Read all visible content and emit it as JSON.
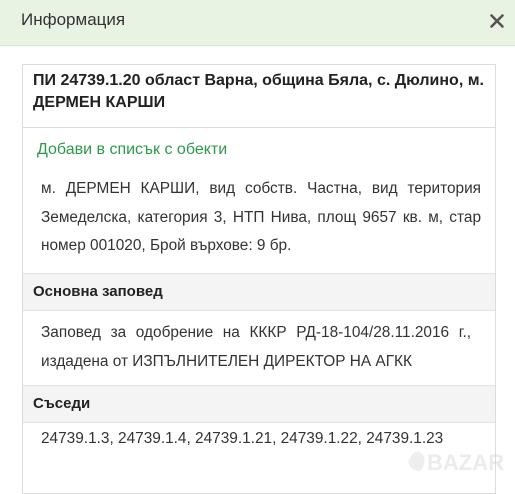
{
  "dialog": {
    "title": "Информация",
    "close_icon": "close-icon"
  },
  "property": {
    "heading": "ПИ 24739.1.20 област Варна, община Бяла, с. Дюлино, м. ДЕРМЕН КАРШИ",
    "add_to_list": "Добави в списък с обекти",
    "description": "м. ДЕРМЕН КАРШИ, вид собств. Частна, вид територия Земеделска, категория 3, НТП Нива, площ 9657 кв. м, стар номер 001020, Брой върхове: 9 бр."
  },
  "order_section": {
    "title": "Основна заповед",
    "text": "Заповед за одобрение на КККР РД-18-104/28.11.2016 г., издадена от ИЗПЪЛНИТЕЛЕН ДИРЕКТОР НА АГКК"
  },
  "neighbors_section": {
    "title": "Съседи",
    "text": "24739.1.3, 24739.1.4, 24739.1.21, 24739.1.22, 24739.1.23"
  },
  "watermark": {
    "text": "BAZAR"
  },
  "colors": {
    "header_bg": "#e8f3e3",
    "link": "#2e9a48",
    "section_bg": "#f4f4f4"
  }
}
